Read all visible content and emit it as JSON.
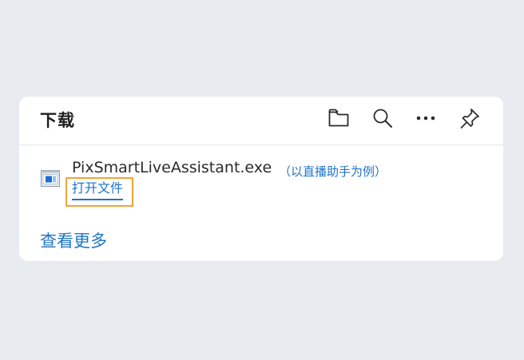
{
  "panel": {
    "title": "下载",
    "toolbar": {
      "folder_icon": "folder-icon",
      "search_icon": "search-icon",
      "more_icon": "more-icon",
      "pin_icon": "pin-icon"
    }
  },
  "download": {
    "file_name": "PixSmartLiveAssistant.exe",
    "note": "（以直播助手为例）",
    "open_link": "打开文件",
    "file_icon": "exe-file-icon"
  },
  "footer": {
    "see_more": "查看更多"
  },
  "colors": {
    "accent": "#1f73c7",
    "highlight": "#f2a43a",
    "background": "#e8ebf0"
  }
}
